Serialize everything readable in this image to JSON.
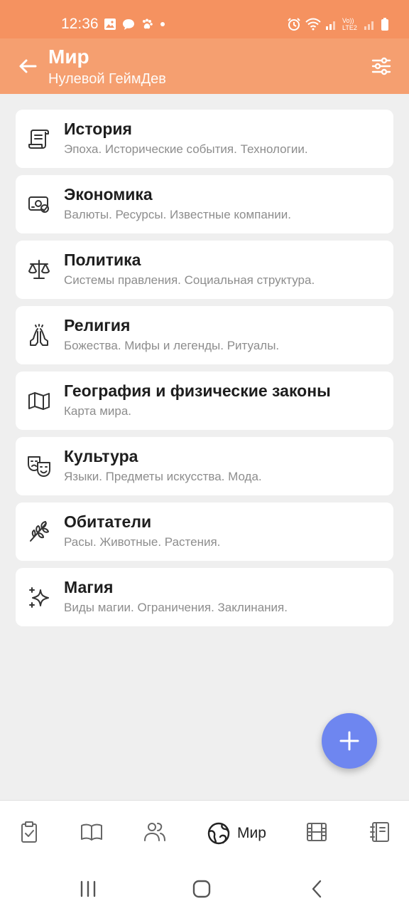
{
  "status_bar": {
    "time": "12:36",
    "volte_label": "Vo)) LTE2"
  },
  "app_bar": {
    "title": "Мир",
    "subtitle": "Нулевой ГеймДев"
  },
  "sections": [
    {
      "icon": "scroll-icon",
      "title": "История",
      "subtitle": "Эпоха. Исторические события. Технологии."
    },
    {
      "icon": "money-icon",
      "title": "Экономика",
      "subtitle": "Валюты. Ресурсы. Известные компании."
    },
    {
      "icon": "scales-icon",
      "title": "Политика",
      "subtitle": "Системы правления. Социальная структура."
    },
    {
      "icon": "praying-hands-icon",
      "title": "Религия",
      "subtitle": "Божества. Мифы и легенды. Ритуалы."
    },
    {
      "icon": "map-icon",
      "title": "География и физические законы",
      "subtitle": "Карта мира."
    },
    {
      "icon": "theater-masks-icon",
      "title": "Культура",
      "subtitle": "Языки. Предметы искусства. Мода."
    },
    {
      "icon": "leaf-branch-icon",
      "title": "Обитатели",
      "subtitle": "Расы. Животные. Растения."
    },
    {
      "icon": "sparkles-icon",
      "title": "Магия",
      "subtitle": "Виды магии. Ограничения. Заклинания."
    }
  ],
  "bottom_nav": {
    "active_label": "Мир"
  },
  "colors": {
    "status_bar": "#f59260",
    "app_bar": "#f59f70",
    "fab": "#6e86f0",
    "background": "#efefef"
  }
}
